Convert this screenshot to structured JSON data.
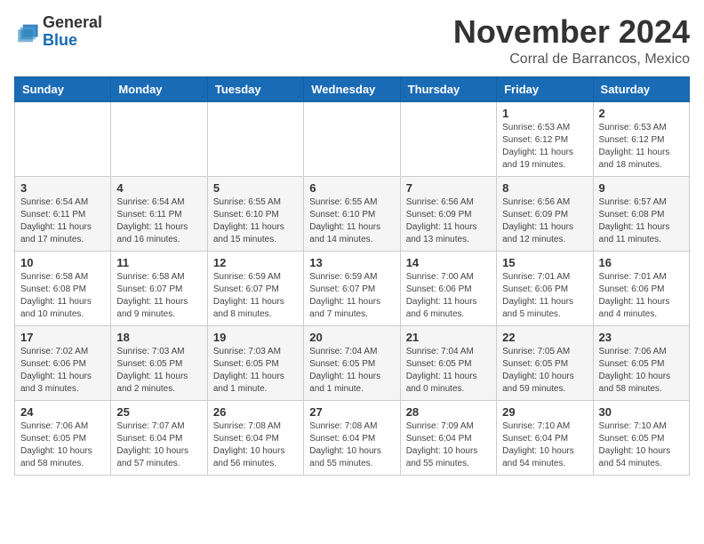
{
  "header": {
    "logo_line1": "General",
    "logo_line2": "Blue",
    "month_title": "November 2024",
    "location": "Corral de Barrancos, Mexico"
  },
  "weekdays": [
    "Sunday",
    "Monday",
    "Tuesday",
    "Wednesday",
    "Thursday",
    "Friday",
    "Saturday"
  ],
  "weeks": [
    [
      {
        "day": "",
        "info": ""
      },
      {
        "day": "",
        "info": ""
      },
      {
        "day": "",
        "info": ""
      },
      {
        "day": "",
        "info": ""
      },
      {
        "day": "",
        "info": ""
      },
      {
        "day": "1",
        "info": "Sunrise: 6:53 AM\nSunset: 6:12 PM\nDaylight: 11 hours and 19 minutes."
      },
      {
        "day": "2",
        "info": "Sunrise: 6:53 AM\nSunset: 6:12 PM\nDaylight: 11 hours and 18 minutes."
      }
    ],
    [
      {
        "day": "3",
        "info": "Sunrise: 6:54 AM\nSunset: 6:11 PM\nDaylight: 11 hours and 17 minutes."
      },
      {
        "day": "4",
        "info": "Sunrise: 6:54 AM\nSunset: 6:11 PM\nDaylight: 11 hours and 16 minutes."
      },
      {
        "day": "5",
        "info": "Sunrise: 6:55 AM\nSunset: 6:10 PM\nDaylight: 11 hours and 15 minutes."
      },
      {
        "day": "6",
        "info": "Sunrise: 6:55 AM\nSunset: 6:10 PM\nDaylight: 11 hours and 14 minutes."
      },
      {
        "day": "7",
        "info": "Sunrise: 6:56 AM\nSunset: 6:09 PM\nDaylight: 11 hours and 13 minutes."
      },
      {
        "day": "8",
        "info": "Sunrise: 6:56 AM\nSunset: 6:09 PM\nDaylight: 11 hours and 12 minutes."
      },
      {
        "day": "9",
        "info": "Sunrise: 6:57 AM\nSunset: 6:08 PM\nDaylight: 11 hours and 11 minutes."
      }
    ],
    [
      {
        "day": "10",
        "info": "Sunrise: 6:58 AM\nSunset: 6:08 PM\nDaylight: 11 hours and 10 minutes."
      },
      {
        "day": "11",
        "info": "Sunrise: 6:58 AM\nSunset: 6:07 PM\nDaylight: 11 hours and 9 minutes."
      },
      {
        "day": "12",
        "info": "Sunrise: 6:59 AM\nSunset: 6:07 PM\nDaylight: 11 hours and 8 minutes."
      },
      {
        "day": "13",
        "info": "Sunrise: 6:59 AM\nSunset: 6:07 PM\nDaylight: 11 hours and 7 minutes."
      },
      {
        "day": "14",
        "info": "Sunrise: 7:00 AM\nSunset: 6:06 PM\nDaylight: 11 hours and 6 minutes."
      },
      {
        "day": "15",
        "info": "Sunrise: 7:01 AM\nSunset: 6:06 PM\nDaylight: 11 hours and 5 minutes."
      },
      {
        "day": "16",
        "info": "Sunrise: 7:01 AM\nSunset: 6:06 PM\nDaylight: 11 hours and 4 minutes."
      }
    ],
    [
      {
        "day": "17",
        "info": "Sunrise: 7:02 AM\nSunset: 6:06 PM\nDaylight: 11 hours and 3 minutes."
      },
      {
        "day": "18",
        "info": "Sunrise: 7:03 AM\nSunset: 6:05 PM\nDaylight: 11 hours and 2 minutes."
      },
      {
        "day": "19",
        "info": "Sunrise: 7:03 AM\nSunset: 6:05 PM\nDaylight: 11 hours and 1 minute."
      },
      {
        "day": "20",
        "info": "Sunrise: 7:04 AM\nSunset: 6:05 PM\nDaylight: 11 hours and 1 minute."
      },
      {
        "day": "21",
        "info": "Sunrise: 7:04 AM\nSunset: 6:05 PM\nDaylight: 11 hours and 0 minutes."
      },
      {
        "day": "22",
        "info": "Sunrise: 7:05 AM\nSunset: 6:05 PM\nDaylight: 10 hours and 59 minutes."
      },
      {
        "day": "23",
        "info": "Sunrise: 7:06 AM\nSunset: 6:05 PM\nDaylight: 10 hours and 58 minutes."
      }
    ],
    [
      {
        "day": "24",
        "info": "Sunrise: 7:06 AM\nSunset: 6:05 PM\nDaylight: 10 hours and 58 minutes."
      },
      {
        "day": "25",
        "info": "Sunrise: 7:07 AM\nSunset: 6:04 PM\nDaylight: 10 hours and 57 minutes."
      },
      {
        "day": "26",
        "info": "Sunrise: 7:08 AM\nSunset: 6:04 PM\nDaylight: 10 hours and 56 minutes."
      },
      {
        "day": "27",
        "info": "Sunrise: 7:08 AM\nSunset: 6:04 PM\nDaylight: 10 hours and 55 minutes."
      },
      {
        "day": "28",
        "info": "Sunrise: 7:09 AM\nSunset: 6:04 PM\nDaylight: 10 hours and 55 minutes."
      },
      {
        "day": "29",
        "info": "Sunrise: 7:10 AM\nSunset: 6:04 PM\nDaylight: 10 hours and 54 minutes."
      },
      {
        "day": "30",
        "info": "Sunrise: 7:10 AM\nSunset: 6:05 PM\nDaylight: 10 hours and 54 minutes."
      }
    ]
  ]
}
